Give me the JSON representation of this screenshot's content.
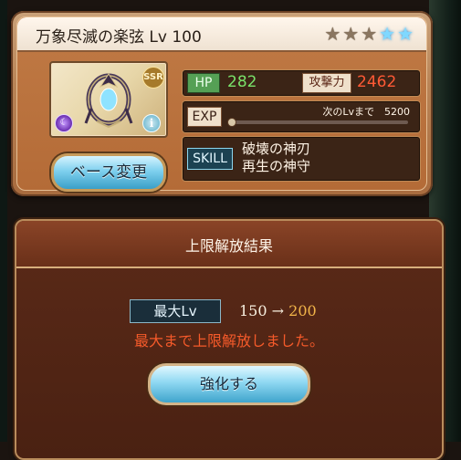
{
  "weapon": {
    "title": "万象尽滅の楽弦 Lv 100",
    "stars": {
      "total": 5,
      "uncaps": 5,
      "transcendence_lit": 2
    },
    "rarity_badge": "SSR",
    "hp_label": "HP",
    "hp": "282",
    "atk_label": "攻撃力",
    "atk": "2462",
    "exp_label": "EXP",
    "exp_next": "次のLvまで　5200",
    "exp_progress": 0.0,
    "skill_label": "SKILL",
    "skills": [
      "破壊の神刃",
      "再生の神守"
    ],
    "base_change_button": "ベース変更",
    "info_glyph": "i"
  },
  "result": {
    "title": "上限解放結果",
    "max_lv_label": "最大Lv",
    "lv_from": "150",
    "arrow": "→",
    "lv_to": "200",
    "message": "最大まで上限解放しました。",
    "upgrade_button": "強化する"
  },
  "colors": {
    "hp_value": "#7ae26a",
    "atk_value": "#ff5a35",
    "new_level": "#f3b64a",
    "result_message": "#f55a2a"
  },
  "icons": [
    "star-icon",
    "element-icon",
    "info-icon",
    "weapon-art"
  ]
}
